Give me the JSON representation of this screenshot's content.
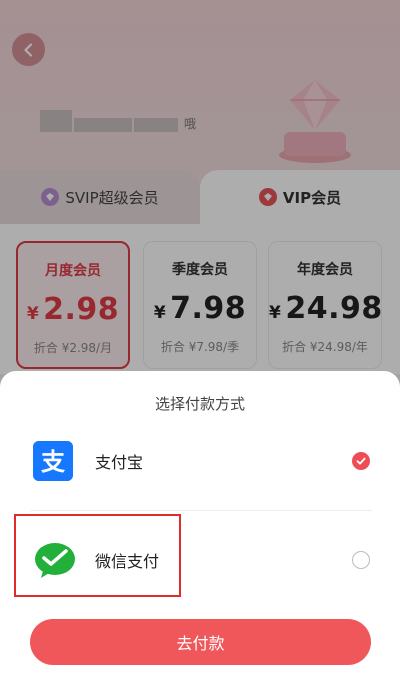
{
  "header": {
    "user_name_suffix": "哦"
  },
  "tabs": [
    {
      "label": "SVIP超级会员",
      "active": false
    },
    {
      "label": "VIP会员",
      "active": true
    }
  ],
  "plans": [
    {
      "title": "月度会员",
      "currency": "¥",
      "price": "2.98",
      "sub": "折合 ¥2.98/月",
      "selected": true
    },
    {
      "title": "季度会员",
      "currency": "¥",
      "price": "7.98",
      "sub": "折合 ¥7.98/季",
      "selected": false
    },
    {
      "title": "年度会员",
      "currency": "¥",
      "price": "24.98",
      "sub": "折合 ¥24.98/年",
      "selected": false
    }
  ],
  "payment_sheet": {
    "title": "选择付款方式",
    "methods": [
      {
        "label": "支付宝",
        "icon": "alipay-icon",
        "checked": true
      },
      {
        "label": "微信支付",
        "icon": "wechat-pay-icon",
        "checked": false
      }
    ],
    "submit_label": "去付款"
  },
  "colors": {
    "accent": "#e03c47",
    "button": "#f0575b",
    "alipay": "#1677ff",
    "wechat": "#22b03b"
  }
}
